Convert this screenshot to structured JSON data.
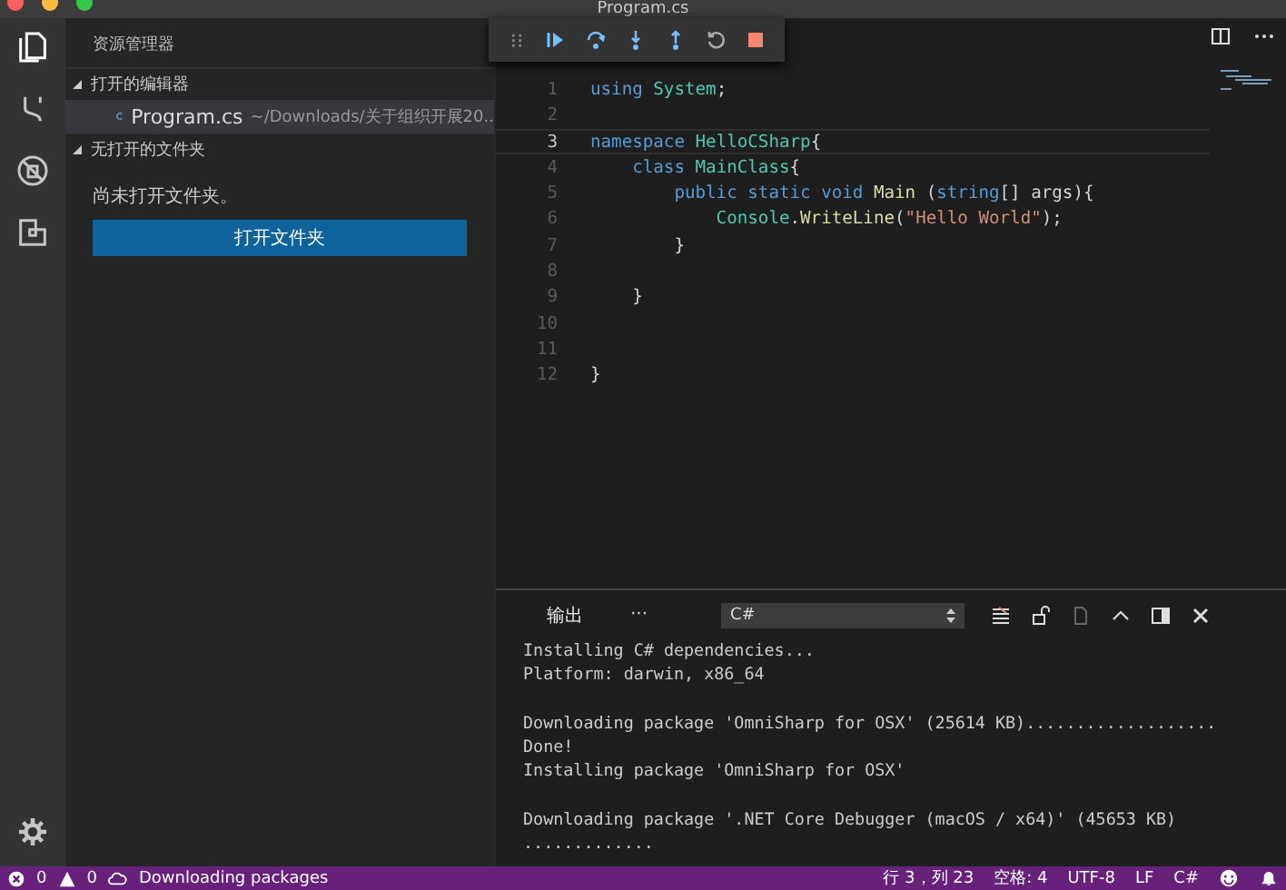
{
  "window": {
    "title": "Program.cs"
  },
  "sidebar": {
    "title": "资源管理器",
    "sections": [
      {
        "title": "打开的编辑器",
        "expanded": true,
        "items": [
          {
            "name": "Program.cs",
            "path": "~/Downloads/关于组织开展20..",
            "selected": true
          }
        ]
      },
      {
        "title": "无打开的文件夹",
        "expanded": true,
        "message": "尚未打开文件夹。",
        "button": "打开文件夹"
      }
    ]
  },
  "editor": {
    "lines": [
      {
        "number": "1",
        "current": false,
        "tokens": [
          {
            "kind": "keyword",
            "text": "using "
          },
          {
            "kind": "type",
            "text": "System"
          },
          {
            "kind": "plain",
            "text": ";"
          }
        ]
      },
      {
        "number": "2",
        "current": false
      },
      {
        "number": "3",
        "current": true,
        "tokens": [
          {
            "kind": "keyword",
            "text": "namespace "
          },
          {
            "kind": "type",
            "text": "HelloCSharp"
          },
          {
            "kind": "plain",
            "text": "{"
          }
        ]
      },
      {
        "number": "4",
        "current": false,
        "tokens": [
          {
            "kind": "keyword",
            "text": "    class "
          },
          {
            "kind": "type",
            "text": "MainClass"
          },
          {
            "kind": "plain",
            "text": "{"
          }
        ]
      },
      {
        "number": "5",
        "current": false,
        "tokens": [
          {
            "kind": "keyword",
            "text": "        public static void "
          },
          {
            "kind": "function",
            "text": "Main"
          },
          {
            "kind": "plain",
            "text": " ("
          },
          {
            "kind": "keyword",
            "text": "string"
          },
          {
            "kind": "plain",
            "text": "[] args){"
          }
        ]
      },
      {
        "number": "6",
        "current": false,
        "tokens": [
          {
            "kind": "type",
            "text": "            Console"
          },
          {
            "kind": "plain",
            "text": "."
          },
          {
            "kind": "function",
            "text": "WriteLine"
          },
          {
            "kind": "plain",
            "text": "("
          },
          {
            "kind": "string",
            "text": "\"Hello World\""
          },
          {
            "kind": "plain",
            "text": ");"
          }
        ]
      },
      {
        "number": "7",
        "current": false,
        "tokens": [
          {
            "kind": "plain",
            "text": "        }"
          }
        ]
      },
      {
        "number": "8",
        "current": false
      },
      {
        "number": "9",
        "current": false,
        "tokens": [
          {
            "kind": "plain",
            "text": "    }"
          }
        ]
      },
      {
        "number": "10",
        "current": false
      },
      {
        "number": "11",
        "current": false
      },
      {
        "number": "12",
        "current": false,
        "tokens": [
          {
            "kind": "plain",
            "text": "}"
          }
        ]
      }
    ]
  },
  "panel": {
    "tabs": [
      {
        "label": "输出",
        "selected": true
      }
    ],
    "more": "···",
    "channel": "C#",
    "output": [
      [
        "Installing C# dependencies...",
        "Platform: darwin, x86_64"
      ],
      [
        "Downloading package 'OmniSharp for OSX' (25614 KB)...................",
        "Done!",
        "Installing package 'OmniSharp for OSX'"
      ],
      [
        "Downloading package '.NET Core Debugger (macOS / x64)' (45653 KB)",
        "............."
      ]
    ]
  },
  "status_bar": {
    "errors": "0",
    "warnings": "0",
    "task": "Downloading packages",
    "position": "行 3，列 23",
    "indent": "空格: 4",
    "encoding": "UTF-8",
    "eol": "LF",
    "language": "C#"
  }
}
